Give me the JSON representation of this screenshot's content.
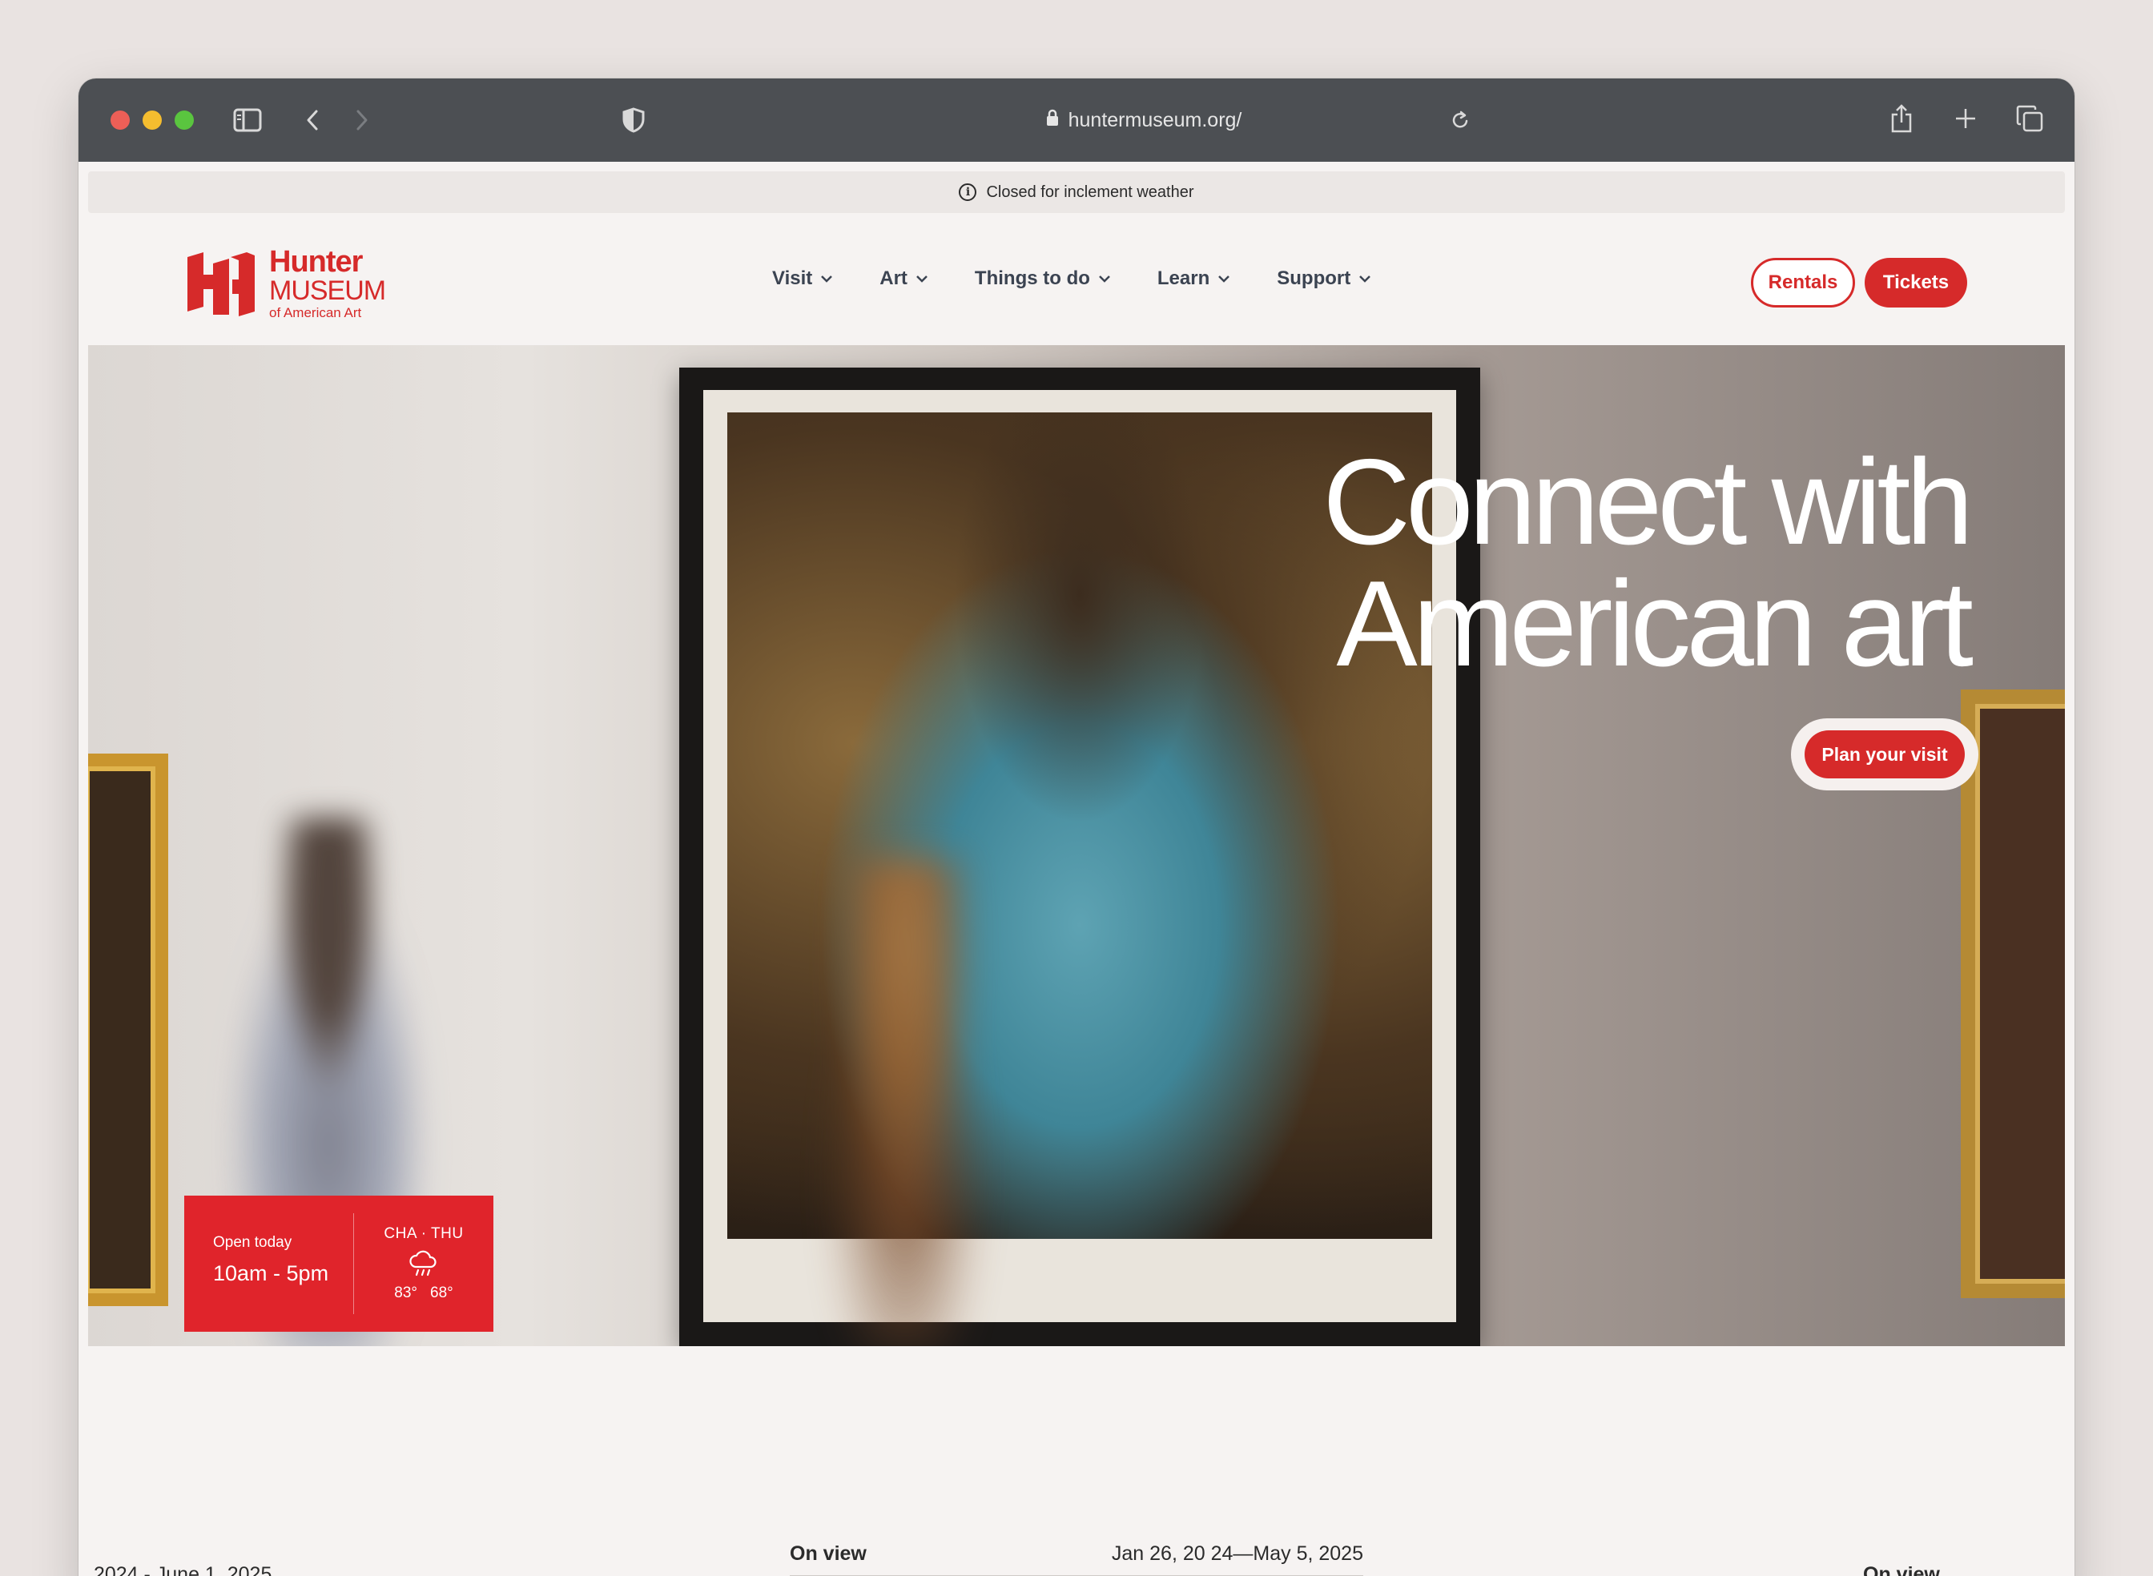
{
  "browser": {
    "url": "huntermuseum.org/",
    "icons": [
      "close-dot",
      "minimize-dot",
      "zoom-dot",
      "sidebar-icon",
      "back-icon",
      "forward-icon",
      "shield-icon",
      "lock-icon",
      "reload-icon",
      "share-icon",
      "new-tab-icon",
      "tabs-overview-icon"
    ]
  },
  "alert": {
    "text": "Closed for inclement weather",
    "icon": "info-icon"
  },
  "logo": {
    "line1": "Hunter",
    "line2": "MUSEUM",
    "line3": "of American Art",
    "color": "#d62a2a"
  },
  "nav": {
    "items": [
      {
        "label": "Visit"
      },
      {
        "label": "Art"
      },
      {
        "label": "Things to do"
      },
      {
        "label": "Learn"
      },
      {
        "label": "Support"
      }
    ],
    "rentals_label": "Rentals",
    "tickets_label": "Tickets"
  },
  "hero": {
    "title_line1": "Connect with",
    "title_line2": "American art",
    "cta_label": "Plan your visit"
  },
  "hours": {
    "open_label": "Open today",
    "hours_value": "10am - 5pm",
    "weather_location_day": "CHA · THU",
    "weather_icon": "rain-cloud-icon",
    "temp_high": "83°",
    "temp_low": "68°",
    "card_color": "#e0242b"
  },
  "exhibitions": {
    "left_date": ",2024  -  June 1, 2025",
    "center_status": "On view",
    "center_date": "Jan 26, 20 24—May 5, 2025",
    "right_status": "On view"
  }
}
